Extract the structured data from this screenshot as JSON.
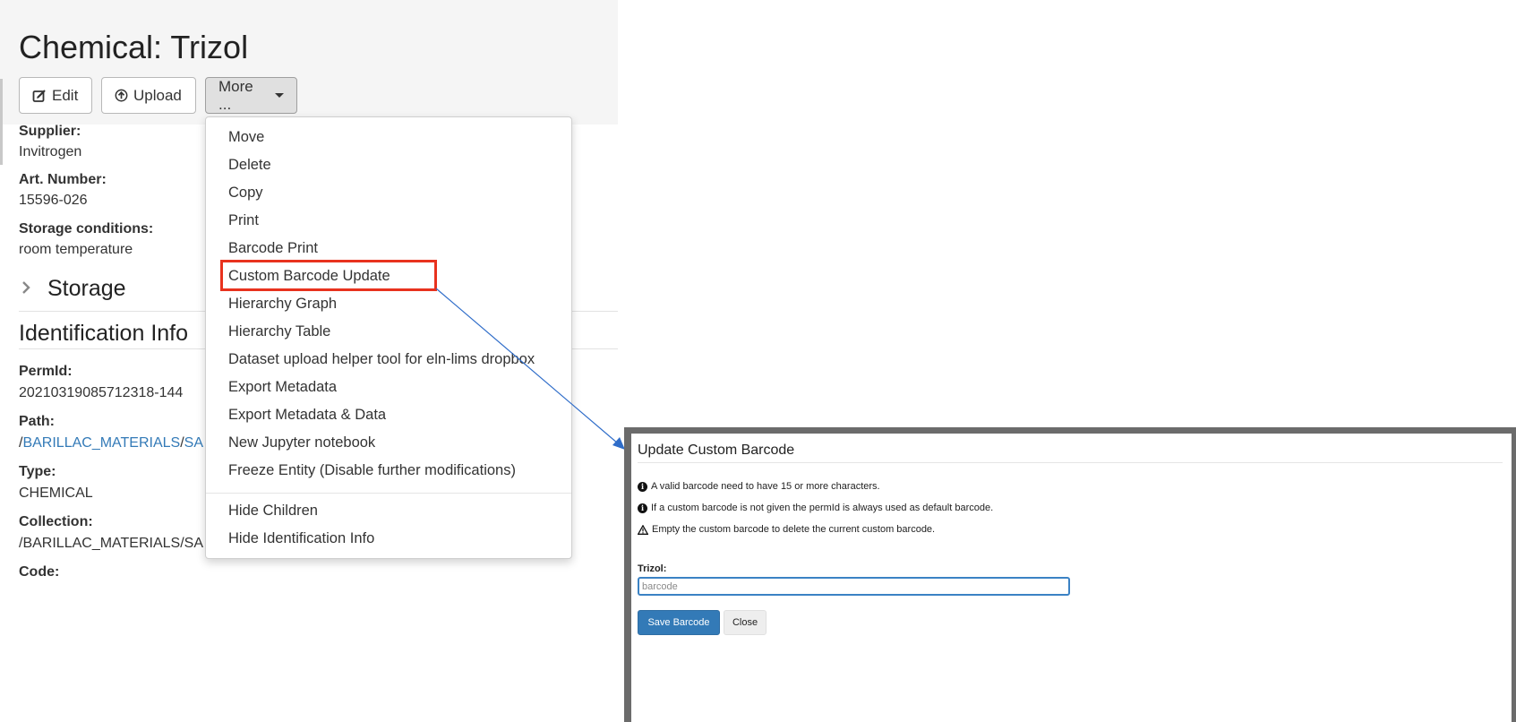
{
  "page": {
    "title": "Chemical: Trizol"
  },
  "toolbar": {
    "edit_label": "Edit",
    "upload_label": "Upload",
    "more_label": "More ..."
  },
  "properties": [
    {
      "label": "Supplier:",
      "value": "Invitrogen"
    },
    {
      "label": "Art. Number:",
      "value": "15596-026"
    },
    {
      "label": "Storage conditions:",
      "value": "room temperature"
    }
  ],
  "sections": {
    "storage": "Storage",
    "identification": "Identification Info"
  },
  "identification": {
    "permid_label": "PermId:",
    "permid_value": "20210319085712318-144",
    "path_label": "Path:",
    "path_prefix": "/",
    "path_link1": "BARILLAC_MATERIALS",
    "path_sep": "/",
    "path_link2": "SA",
    "type_label": "Type:",
    "type_value": "CHEMICAL",
    "collection_label": "Collection:",
    "collection_value": "/BARILLAC_MATERIALS/SA",
    "code_label": "Code:"
  },
  "menu": {
    "items": [
      "Move",
      "Delete",
      "Copy",
      "Print",
      "Barcode Print",
      "Custom Barcode Update",
      "Hierarchy Graph",
      "Hierarchy Table",
      "Dataset upload helper tool for eln-lims dropbox",
      "Export Metadata",
      "Export Metadata & Data",
      "New Jupyter notebook",
      "Freeze Entity (Disable further modifications)"
    ],
    "secondary_items": [
      "Hide Children",
      "Hide Identification Info"
    ],
    "highlighted": "Custom Barcode Update"
  },
  "modal": {
    "title": "Update Custom Barcode",
    "notes": [
      {
        "icon": "info-icon",
        "text": "A valid barcode need to have 15 or more characters."
      },
      {
        "icon": "info-icon",
        "text": "If a custom barcode is not given the permId is always used as default barcode."
      },
      {
        "icon": "warning-icon",
        "text": "Empty the custom barcode to delete the current custom barcode."
      }
    ],
    "field_label": "Trizol:",
    "input_placeholder": "barcode",
    "input_value": "",
    "save_label": "Save Barcode",
    "close_label": "Close"
  },
  "colors": {
    "highlight": "#e8321e",
    "primary": "#337ab7",
    "link": "#337ab7",
    "arrow": "#2f6dc9"
  }
}
